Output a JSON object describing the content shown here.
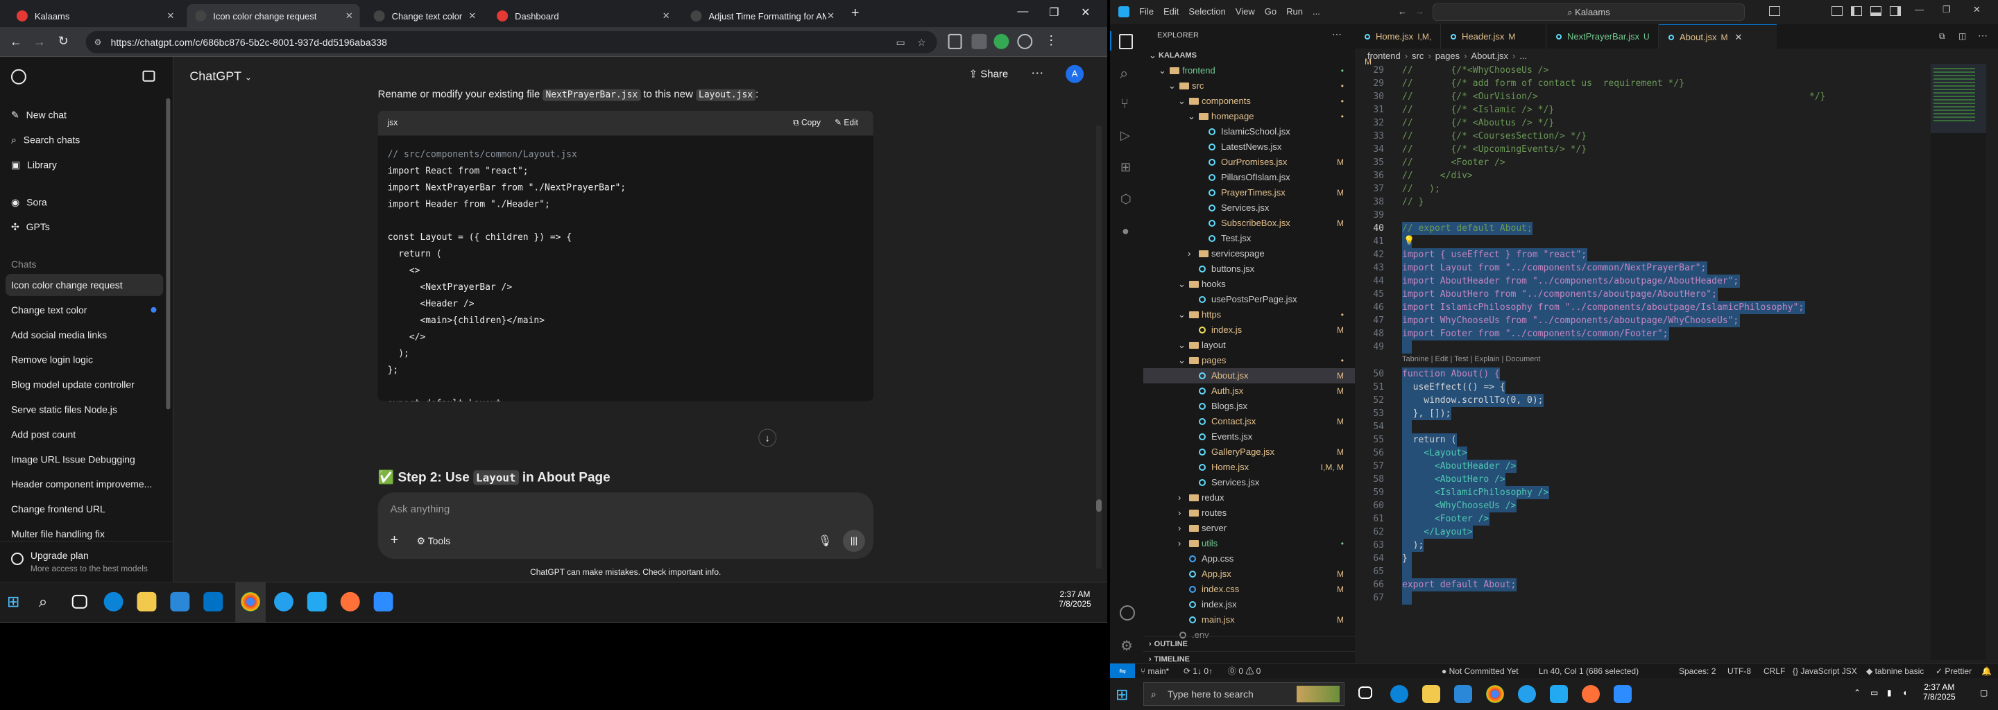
{
  "browser": {
    "tabs": [
      {
        "title": "Kalaams",
        "fav_color": "#e53935"
      },
      {
        "title": "Icon color change request",
        "fav_color": "#444"
      },
      {
        "title": "Change text color",
        "fav_color": "#444"
      },
      {
        "title": "Dashboard",
        "fav_color": "#e53935"
      },
      {
        "title": "Adjust Time Formatting for AM",
        "fav_color": "#444"
      }
    ],
    "new_tab": "+",
    "url": "https://chatgpt.com/c/686bc876-5b2c-8001-937d-dd5196aba338",
    "window_controls": [
      "—",
      "❐",
      "✕"
    ]
  },
  "chatgpt": {
    "sidebar": {
      "nav": [
        "New chat",
        "Search chats",
        "Library",
        "Sora",
        "GPTs"
      ],
      "chats_heading": "Chats",
      "chats": [
        "Icon color change request",
        "Change text color",
        "Add social media links",
        "Remove login logic",
        "Blog model update controller",
        "Serve static files Node.js",
        "Add post count",
        "Image URL Issue Debugging",
        "Header component improveme...",
        "Change frontend URL",
        "Multer file handling fix"
      ],
      "upgrade_title": "Upgrade plan",
      "upgrade_sub": "More access to the best models"
    },
    "header": {
      "model": "ChatGPT",
      "share": "Share",
      "avatar": "A"
    },
    "message": {
      "intro_a": "Rename or modify your existing file ",
      "intro_code1": "NextPrayerBar.jsx",
      "intro_b": " to this new ",
      "intro_code2": "Layout.jsx",
      "intro_c": ":",
      "code_lang": "jsx",
      "copy": "Copy",
      "edit": "Edit",
      "code_lines": [
        "// src/components/common/Layout.jsx",
        "import React from \"react\";",
        "import NextPrayerBar from \"./NextPrayerBar\";",
        "import Header from \"./Header\";",
        "",
        "const Layout = ({ children }) => {",
        "  return (",
        "    <>",
        "      <NextPrayerBar />",
        "      <Header />",
        "      <main>{children}</main>",
        "    </>",
        "  );",
        "};",
        "",
        "export default Layout;"
      ],
      "step_icon": "✅",
      "step_a": "Step 2: Use ",
      "step_code": "Layout",
      "step_b": " in About Page"
    },
    "composer": {
      "placeholder": "Ask anything",
      "plus": "+",
      "tools": "Tools"
    },
    "disclaimer": "ChatGPT can make mistakes. Check important info."
  },
  "taskbar_left": {
    "time": "2:37 AM",
    "date": "7/8/2025"
  },
  "vscode": {
    "menu": [
      "File",
      "Edit",
      "Selection",
      "View",
      "Go",
      "Run",
      "..."
    ],
    "search": "Kalaams",
    "explorer_title": "EXPLORER",
    "tree": [
      {
        "name": "KALAAMS",
        "depth": 0,
        "kind": "root",
        "open": true
      },
      {
        "name": "frontend",
        "depth": 1,
        "kind": "folder",
        "open": true,
        "badge": "•",
        "color": "#73c991"
      },
      {
        "name": "src",
        "depth": 2,
        "kind": "folder",
        "open": true,
        "badge": "•",
        "color": "#e2c08d"
      },
      {
        "name": "components",
        "depth": 3,
        "kind": "folder",
        "open": true,
        "badge": "•",
        "color": "#e2c08d"
      },
      {
        "name": "homepage",
        "depth": 4,
        "kind": "folder",
        "open": true,
        "badge": "•",
        "color": "#e2c08d"
      },
      {
        "name": "IslamicSchool.jsx",
        "depth": 5,
        "kind": "file",
        "badge": "",
        "color": "#cccccc"
      },
      {
        "name": "LatestNews.jsx",
        "depth": 5,
        "kind": "file",
        "badge": "",
        "color": "#cccccc"
      },
      {
        "name": "OurPromises.jsx",
        "depth": 5,
        "kind": "file",
        "badge": "M",
        "color": "#e2c08d"
      },
      {
        "name": "PillarsOfIslam.jsx",
        "depth": 5,
        "kind": "file",
        "badge": "",
        "color": "#cccccc"
      },
      {
        "name": "PrayerTimes.jsx",
        "depth": 5,
        "kind": "file",
        "badge": "M",
        "color": "#e2c08d"
      },
      {
        "name": "Services.jsx",
        "depth": 5,
        "kind": "file",
        "badge": "",
        "color": "#cccccc"
      },
      {
        "name": "SubscribeBox.jsx",
        "depth": 5,
        "kind": "file",
        "badge": "M",
        "color": "#e2c08d"
      },
      {
        "name": "Test.jsx",
        "depth": 5,
        "kind": "file",
        "badge": "",
        "color": "#cccccc"
      },
      {
        "name": "servicespage",
        "depth": 4,
        "kind": "folder",
        "open": false,
        "badge": "",
        "color": "#cccccc"
      },
      {
        "name": "buttons.jsx",
        "depth": 4,
        "kind": "file",
        "badge": "",
        "color": "#cccccc"
      },
      {
        "name": "hooks",
        "depth": 3,
        "kind": "folder",
        "open": true,
        "badge": "",
        "color": "#cccccc"
      },
      {
        "name": "usePostsPerPage.jsx",
        "depth": 4,
        "kind": "file",
        "badge": "",
        "color": "#cccccc"
      },
      {
        "name": "https",
        "depth": 3,
        "kind": "folder",
        "open": true,
        "badge": "•",
        "color": "#e2c08d"
      },
      {
        "name": "index.js",
        "depth": 4,
        "kind": "file",
        "badge": "M",
        "color": "#e2c08d"
      },
      {
        "name": "layout",
        "depth": 3,
        "kind": "folder",
        "open": true,
        "badge": "",
        "color": "#cccccc"
      },
      {
        "name": "pages",
        "depth": 3,
        "kind": "folder",
        "open": true,
        "badge": "•",
        "color": "#e2c08d"
      },
      {
        "name": "About.jsx",
        "depth": 4,
        "kind": "file",
        "badge": "M",
        "color": "#e2c08d",
        "selected": true
      },
      {
        "name": "Auth.jsx",
        "depth": 4,
        "kind": "file",
        "badge": "M",
        "color": "#e2c08d"
      },
      {
        "name": "Blogs.jsx",
        "depth": 4,
        "kind": "file",
        "badge": "",
        "color": "#cccccc"
      },
      {
        "name": "Contact.jsx",
        "depth": 4,
        "kind": "file",
        "badge": "M",
        "color": "#e2c08d"
      },
      {
        "name": "Events.jsx",
        "depth": 4,
        "kind": "file",
        "badge": "",
        "color": "#cccccc"
      },
      {
        "name": "GalleryPage.jsx",
        "depth": 4,
        "kind": "file",
        "badge": "M",
        "color": "#e2c08d"
      },
      {
        "name": "Home.jsx",
        "depth": 4,
        "kind": "file",
        "badge": "I,M, M",
        "color": "#e2c08d"
      },
      {
        "name": "Services.jsx",
        "depth": 4,
        "kind": "file",
        "badge": "",
        "color": "#cccccc"
      },
      {
        "name": "redux",
        "depth": 3,
        "kind": "folder",
        "open": false,
        "badge": "",
        "color": "#cccccc"
      },
      {
        "name": "routes",
        "depth": 3,
        "kind": "folder",
        "open": false,
        "badge": "",
        "color": "#cccccc"
      },
      {
        "name": "server",
        "depth": 3,
        "kind": "folder",
        "open": false,
        "badge": "",
        "color": "#cccccc"
      },
      {
        "name": "utils",
        "depth": 3,
        "kind": "folder",
        "open": false,
        "badge": "•",
        "color": "#73c991"
      },
      {
        "name": "App.css",
        "depth": 3,
        "kind": "file",
        "badge": "",
        "color": "#cccccc"
      },
      {
        "name": "App.jsx",
        "depth": 3,
        "kind": "file",
        "badge": "M",
        "color": "#e2c08d"
      },
      {
        "name": "index.css",
        "depth": 3,
        "kind": "file",
        "badge": "M",
        "color": "#e2c08d"
      },
      {
        "name": "index.jsx",
        "depth": 3,
        "kind": "file",
        "badge": "",
        "color": "#cccccc"
      },
      {
        "name": "main.jsx",
        "depth": 3,
        "kind": "file",
        "badge": "M",
        "color": "#e2c08d"
      },
      {
        "name": ".env",
        "depth": 2,
        "kind": "file",
        "badge": "",
        "color": "#888888"
      }
    ],
    "outline": "OUTLINE",
    "timeline": "TIMELINE",
    "tabs": [
      {
        "name": "Home.jsx",
        "badge": "I,M, M",
        "color": "#e2c08d"
      },
      {
        "name": "Header.jsx",
        "badge": "M",
        "color": "#e2c08d"
      },
      {
        "name": "NextPrayerBar.jsx",
        "badge": "U",
        "color": "#73c991"
      },
      {
        "name": "About.jsx",
        "badge": "M",
        "color": "#e2c08d",
        "active": true
      }
    ],
    "breadcrumb": [
      "frontend",
      "src",
      "pages",
      "About.jsx",
      "..."
    ],
    "lenses": "Tabnine | Edit | Test | Explain | Document",
    "code": [
      {
        "n": 29,
        "t": "//       {/*<WhyChooseUs />"
      },
      {
        "n": 29,
        "t": "//       {/* add form of contact us  requirement */}"
      },
      {
        "n": 30,
        "t": "//       {/* <OurVision/>                                                  */}"
      },
      {
        "n": 31,
        "t": "//       {/* <Islamic /> */}"
      },
      {
        "n": 32,
        "t": "//       {/* <Aboutus /> */}"
      },
      {
        "n": 33,
        "t": "//       {/* <CoursesSection/> */}"
      },
      {
        "n": 34,
        "t": "//       {/* <UpcomingEvents/> */}"
      },
      {
        "n": 35,
        "t": "//       <Footer />"
      },
      {
        "n": 36,
        "t": "//     </div>"
      },
      {
        "n": 37,
        "t": "//   );"
      },
      {
        "n": 38,
        "t": "// }"
      },
      {
        "n": 39,
        "t": ""
      },
      {
        "n": 40,
        "t": "// export default About;"
      },
      {
        "n": 41,
        "t": ""
      },
      {
        "n": 42,
        "t": "import { useEffect } from \"react\";"
      },
      {
        "n": 43,
        "t": "import Layout from \"../components/common/NextPrayerBar\";"
      },
      {
        "n": 44,
        "t": "import AboutHeader from \"../components/aboutpage/AboutHeader\";"
      },
      {
        "n": 45,
        "t": "import AboutHero from \"../components/aboutpage/AboutHero\";"
      },
      {
        "n": 46,
        "t": "import IslamicPhilosophy from \"../components/aboutpage/IslamicPhilosophy\";"
      },
      {
        "n": 47,
        "t": "import WhyChooseUs from \"../components/aboutpage/WhyChooseUs\";"
      },
      {
        "n": 48,
        "t": "import Footer from \"../components/common/Footer\";"
      },
      {
        "n": 49,
        "t": ""
      },
      {
        "n": 50,
        "t": "function About() {"
      },
      {
        "n": 51,
        "t": "  useEffect(() => {"
      },
      {
        "n": 52,
        "t": "    window.scrollTo(0, 0);"
      },
      {
        "n": 53,
        "t": "  }, []);"
      },
      {
        "n": 54,
        "t": ""
      },
      {
        "n": 55,
        "t": "  return ("
      },
      {
        "n": 56,
        "t": "    <Layout>"
      },
      {
        "n": 57,
        "t": "      <AboutHeader />"
      },
      {
        "n": 58,
        "t": "      <AboutHero />"
      },
      {
        "n": 59,
        "t": "      <IslamicPhilosophy />"
      },
      {
        "n": 60,
        "t": "      <WhyChooseUs />"
      },
      {
        "n": 61,
        "t": "      <Footer />"
      },
      {
        "n": 62,
        "t": "    </Layout>"
      },
      {
        "n": 63,
        "t": "  );"
      },
      {
        "n": 64,
        "t": "}"
      },
      {
        "n": 65,
        "t": ""
      },
      {
        "n": 66,
        "t": "export default About;"
      },
      {
        "n": 67,
        "t": ""
      }
    ],
    "status": {
      "branch": "main*",
      "sync": "1↓ 0↑",
      "problems": "⓪ 0 ⚠ 0",
      "not_committed": "Not Committed Yet",
      "cursor": "Ln 40, Col 1 (686 selected)",
      "spaces": "Spaces: 2",
      "encoding": "UTF-8",
      "eol": "CRLF",
      "language": "JavaScript JSX",
      "tabnine": "tabnine basic",
      "prettier": "Prettier"
    },
    "taskbar": {
      "search": "Type here to search",
      "time": "2:37 AM",
      "date": "7/8/2025"
    }
  }
}
